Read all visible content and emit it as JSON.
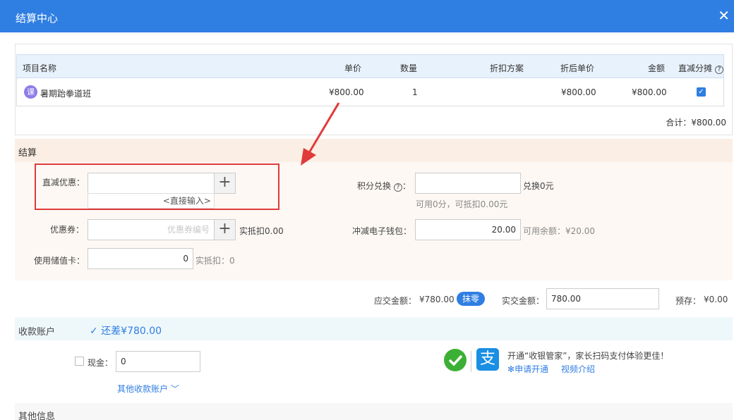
{
  "dialog": {
    "title": "结算中心"
  },
  "table": {
    "headers": [
      "项目名称",
      "单价",
      "数量",
      "折扣方案",
      "折后单价",
      "金额",
      "直减分摊"
    ],
    "rows": [
      {
        "badge": "课",
        "name": "暑期跆拳道班",
        "unit_price": "¥800.00",
        "qty": "1",
        "discount_plan": "",
        "discounted_price": "¥800.00",
        "amount": "¥800.00",
        "apportion_checked": true
      }
    ],
    "total": "合计：¥800.00"
  },
  "settlement": {
    "section_title": "结算",
    "direct_discount": {
      "label": "直减优惠：",
      "value": "",
      "dropdown_hint": "<直接输入>"
    },
    "coupon": {
      "label": "优惠券：",
      "placeholder": "优惠券编号",
      "deduct_text": "实抵扣0.00"
    },
    "stored_card": {
      "label": "使用储值卡：",
      "value": "0",
      "deduct_text": "实抵扣：0"
    },
    "points": {
      "label": "积分兑换",
      "suffix": "：",
      "value": "",
      "exchange_text": "兑换0元",
      "available_text": "可用0分，可抵扣0.00元"
    },
    "wallet": {
      "label": "冲减电子钱包：",
      "value": "20.00",
      "balance_text": "可用余额：¥20.00"
    }
  },
  "payment_summary": {
    "due_label": "应交金额：",
    "due_amount": "¥780.00",
    "round_button": "抹零",
    "paid_label": "实交金额：",
    "paid_value": "780.00",
    "prepaid_label": "预存：",
    "prepaid_amount": "¥0.00"
  },
  "accounts": {
    "section_title": "收款账户",
    "status": "✓ 还差¥780.00",
    "cash": {
      "label": "现金：",
      "value": "0",
      "checked": false
    },
    "more_link": "其他收款账户",
    "promo": {
      "text": "开通“收银管家”，家长扫码支付体验更佳！",
      "apply_link": "申请开通",
      "video_link": "视频介绍"
    }
  },
  "other": {
    "section_title": "其他信息"
  },
  "colors": {
    "header_blue": "#2f7ee2",
    "annotation_red": "#e03a3a",
    "due_red": "#cc1b1b",
    "prepaid_green": "#1a9a3c"
  }
}
